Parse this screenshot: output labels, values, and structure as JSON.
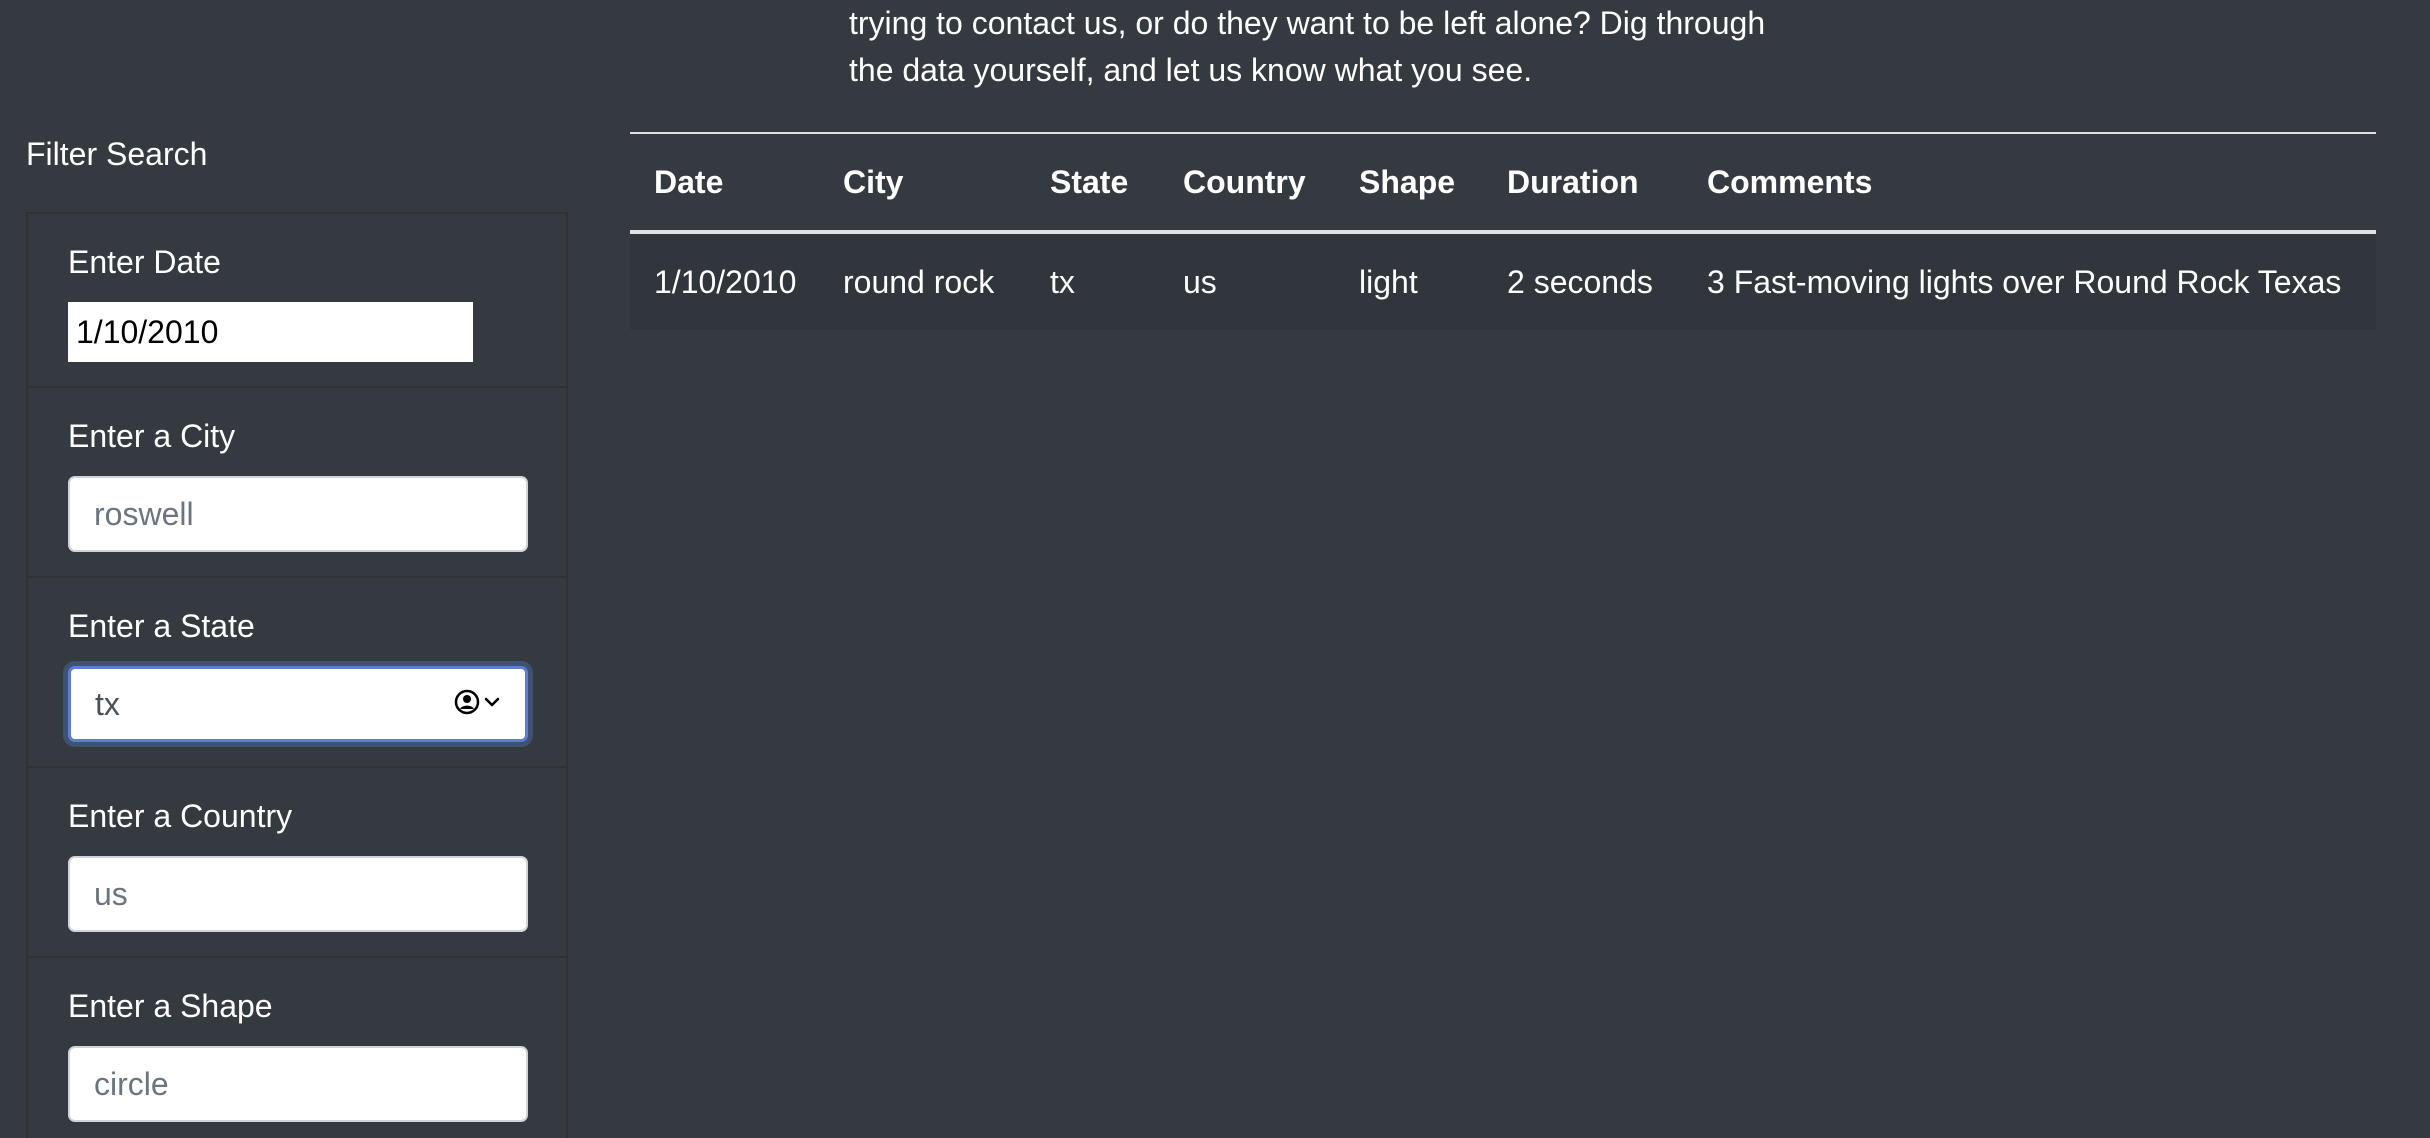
{
  "intro": {
    "line1": "trying to contact us, or do they want to be left alone? Dig through",
    "line2": "the data yourself, and let us know what you see."
  },
  "filters": {
    "title": "Filter Search",
    "date": {
      "label": "Enter Date",
      "value": "1/10/2010"
    },
    "city": {
      "label": "Enter a City",
      "placeholder": "roswell"
    },
    "state": {
      "label": "Enter a State",
      "value": "tx"
    },
    "country": {
      "label": "Enter a Country",
      "placeholder": "us"
    },
    "shape": {
      "label": "Enter a Shape",
      "placeholder": "circle"
    }
  },
  "table": {
    "headers": [
      "Date",
      "City",
      "State",
      "Country",
      "Shape",
      "Duration",
      "Comments"
    ],
    "rows": [
      [
        "1/10/2010",
        "round rock",
        "tx",
        "us",
        "light",
        "2 seconds",
        "3 Fast-moving lights over Round Rock Texas"
      ]
    ]
  },
  "icons": {
    "autofill": "contact-autofill-icon",
    "dropdown": "chevron-down-icon"
  }
}
